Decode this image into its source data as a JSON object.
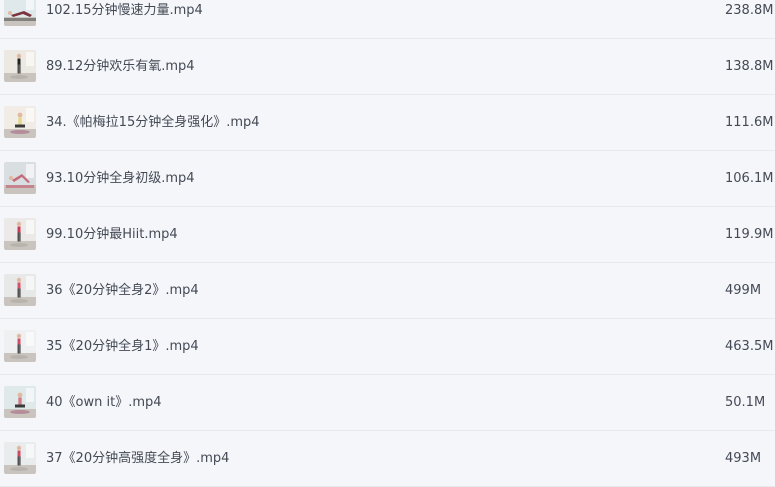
{
  "files": [
    {
      "name": "102.15分钟慢速力量.mp4",
      "size": "238.8M",
      "thumb": "floor-pose",
      "bg": "#dfe8ea",
      "accent": "#7a3340"
    },
    {
      "name": "89.12分钟欢乐有氧.mp4",
      "size": "138.8M",
      "thumb": "standing-pose",
      "bg": "#ece8e2",
      "accent": "#222222"
    },
    {
      "name": "34.《帕梅拉15分钟全身强化》.mp4",
      "size": "111.6M",
      "thumb": "kneeling-pose",
      "bg": "#f1ede6",
      "accent": "#e6d68a"
    },
    {
      "name": "93.10分钟全身初级.mp4",
      "size": "106.1M",
      "thumb": "plank-pose",
      "bg": "#d9dfe0",
      "accent": "#c46a7a"
    },
    {
      "name": "99.10分钟最Hiit.mp4",
      "size": "119.9M",
      "thumb": "standing-pose",
      "bg": "#eceae8",
      "accent": "#cc3b56"
    },
    {
      "name": "36《20分钟全身2》.mp4",
      "size": "499M",
      "thumb": "standing-pose",
      "bg": "#e7e9e9",
      "accent": "#d4526a"
    },
    {
      "name": "35《20分钟全身1》.mp4",
      "size": "463.5M",
      "thumb": "standing-pose",
      "bg": "#eef0f1",
      "accent": "#d04d68"
    },
    {
      "name": "40《own it》.mp4",
      "size": "50.1M",
      "thumb": "kneeling-pose",
      "bg": "#dfe9ea",
      "accent": "#d27b86"
    },
    {
      "name": "37《20分钟高强度全身》.mp4",
      "size": "493M",
      "thumb": "standing-pose",
      "bg": "#e9ecec",
      "accent": "#cf4a63"
    }
  ]
}
